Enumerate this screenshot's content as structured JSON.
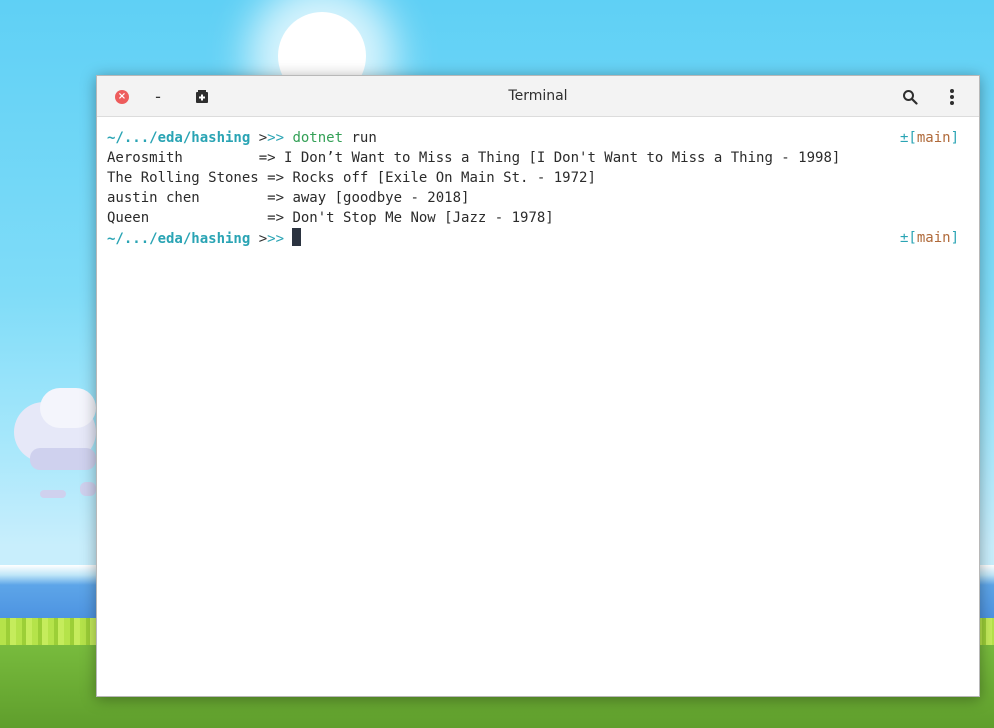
{
  "window": {
    "title": "Terminal",
    "buttons": {
      "close_icon": "close-icon",
      "minimize_icon": "minimize-icon",
      "new_tab_icon": "new-tab-icon",
      "search_icon": "search-icon",
      "menu_icon": "kebab-menu-icon"
    }
  },
  "terminal": {
    "prompt_path": "~/.../eda/hashing",
    "prompt_gt": " >",
    "prompt_arrows": ">> ",
    "command_name": "dotnet",
    "command_args": " run",
    "git_marker": "±",
    "git_bracket_open": "[",
    "git_branch": "main",
    "git_bracket_close": "]",
    "output": [
      {
        "artist": "Aerosmith         ",
        "arrow": "=> ",
        "song": "I Don’t Want to Miss a Thing [I Don't Want to Miss a Thing - 1998]"
      },
      {
        "artist": "The Rolling Stones",
        "arrow": " => ",
        "song": "Rocks off [Exile On Main St. - 1972]"
      },
      {
        "artist": "austin chen       ",
        "arrow": " => ",
        "song": "away [goodbye - 2018]"
      },
      {
        "artist": "Queen             ",
        "arrow": " => ",
        "song": "Don't Stop Me Now [Jazz - 1978]"
      }
    ]
  },
  "colors": {
    "prompt": "#2aa4b4",
    "command": "#33a056",
    "branch": "#b06a3a",
    "close": "#ed5c5c"
  }
}
